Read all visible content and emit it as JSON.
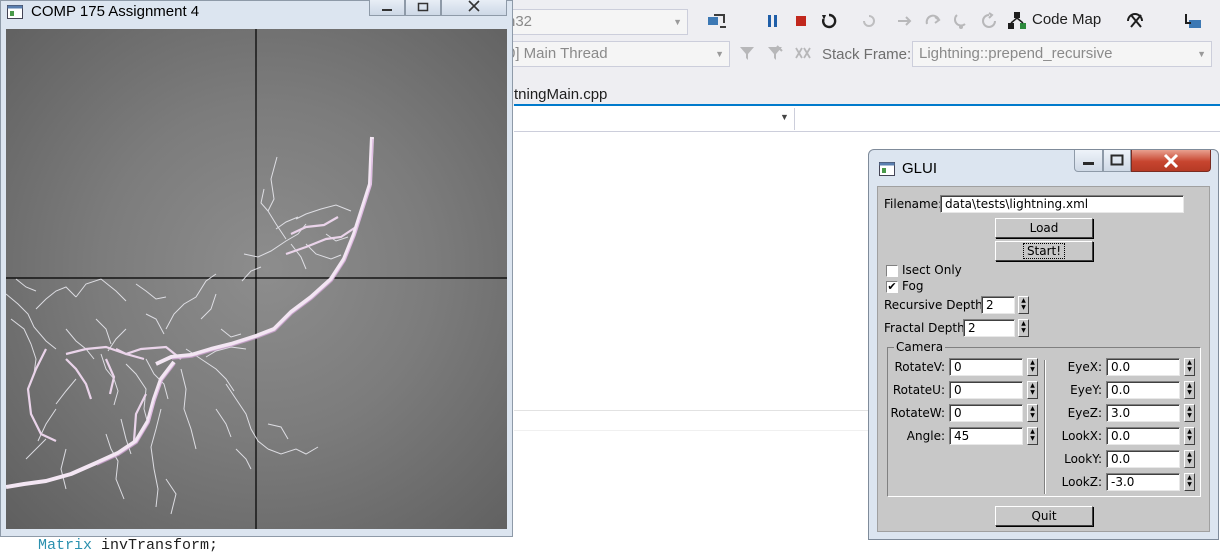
{
  "vs": {
    "config_combo": "n32",
    "thread_combo": "0] Main Thread",
    "stack_frame_label": "Stack Frame:",
    "stack_frame_value": "Lightning::prepend_recursive",
    "code_map_label": "Code Map",
    "tab_label": "tningMain.cpp",
    "code_type": "Matrix",
    "code_rest": " invTransform;"
  },
  "gl_window": {
    "title": "COMP 175 Assignment 4"
  },
  "glui": {
    "title": "GLUI",
    "filename_label": "Filename:",
    "filename_value": "data\\tests\\lightning.xml",
    "load_label": "Load",
    "start_label": "Start!",
    "isect_label": "Isect Only",
    "isect_checked": false,
    "fog_label": "Fog",
    "fog_checked": true,
    "recursive_depth_label": "Recursive Depth",
    "recursive_depth_value": "2",
    "fractal_depth_label": "Fractal Depth",
    "fractal_depth_value": "2",
    "camera_label": "Camera",
    "left_fields": [
      {
        "label": "RotateV:",
        "value": "0"
      },
      {
        "label": "RotateU:",
        "value": "0"
      },
      {
        "label": "RotateW:",
        "value": "0"
      },
      {
        "label": "Angle:",
        "value": "45"
      }
    ],
    "right_fields": [
      {
        "label": "EyeX:",
        "value": "0.0"
      },
      {
        "label": "EyeY:",
        "value": "0.0"
      },
      {
        "label": "EyeZ:",
        "value": "3.0"
      },
      {
        "label": "LookX:",
        "value": "0.0"
      },
      {
        "label": "LookY:",
        "value": "0.0"
      },
      {
        "label": "LookZ:",
        "value": "-3.0"
      }
    ],
    "quit_label": "Quit"
  }
}
